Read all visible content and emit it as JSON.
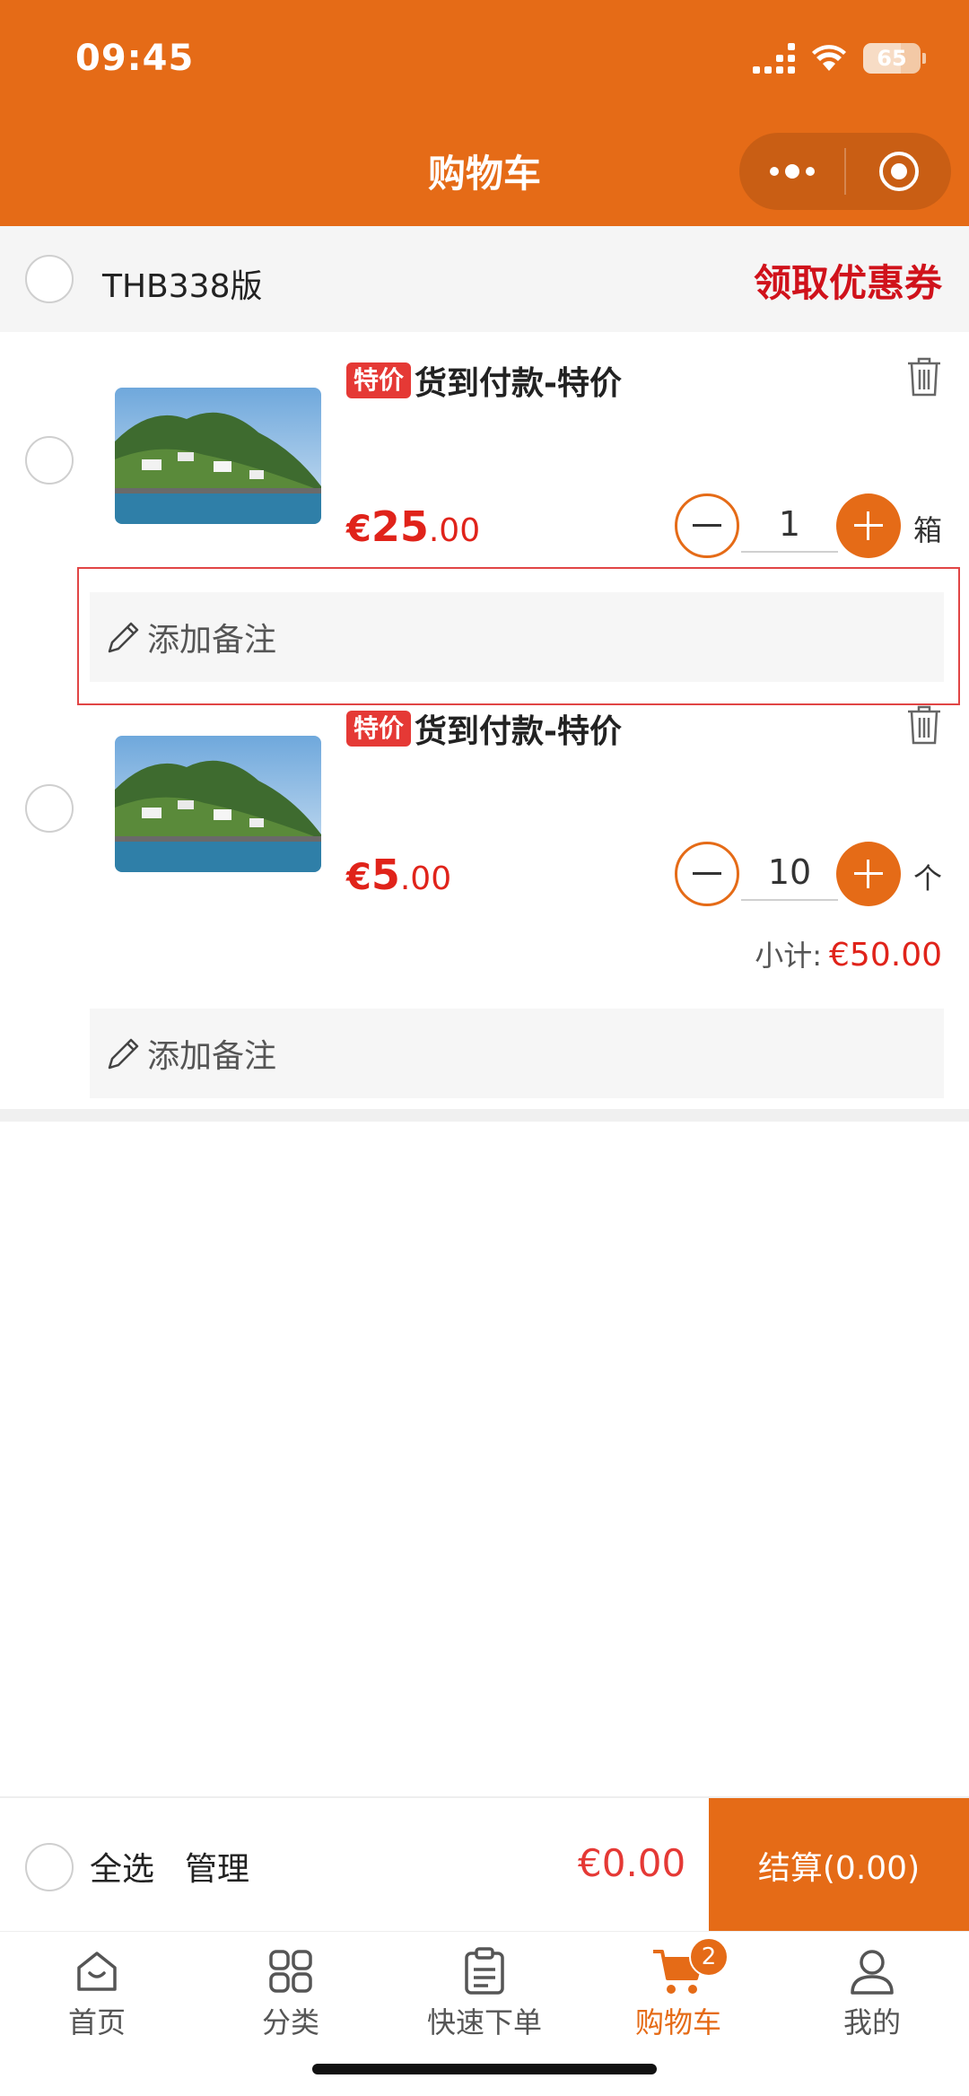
{
  "status_bar": {
    "time": "09:45",
    "battery": "65"
  },
  "header": {
    "title": "购物车"
  },
  "store": {
    "name": "THB338版",
    "coupon_label": "领取优惠券"
  },
  "items": [
    {
      "tag": "特价",
      "title": "货到付款-特价",
      "price_symbol": "€",
      "price_int": "25",
      "price_dec": ".00",
      "quantity": "1",
      "unit": "箱",
      "note_placeholder": "添加备注"
    },
    {
      "tag": "特价",
      "title": "货到付款-特价",
      "price_symbol": "€",
      "price_int": "5",
      "price_dec": ".00",
      "quantity": "10",
      "unit": "个",
      "subtotal_label": "小计:",
      "subtotal_value": "€50.00",
      "note_placeholder": "添加备注"
    }
  ],
  "checkout": {
    "select_all": "全选",
    "manage": "管理",
    "total": "€0.00",
    "button": "结算(0.00)"
  },
  "tabbar": {
    "tabs": [
      {
        "label": "首页",
        "icon": "home-icon"
      },
      {
        "label": "分类",
        "icon": "category-icon"
      },
      {
        "label": "快速下单",
        "icon": "clipboard-icon"
      },
      {
        "label": "购物车",
        "icon": "cart-icon",
        "badge": "2",
        "active": true
      },
      {
        "label": "我的",
        "icon": "user-icon"
      }
    ]
  },
  "colors": {
    "brand": "#e56b17",
    "price": "#e0231a",
    "coupon": "#d0121b"
  }
}
